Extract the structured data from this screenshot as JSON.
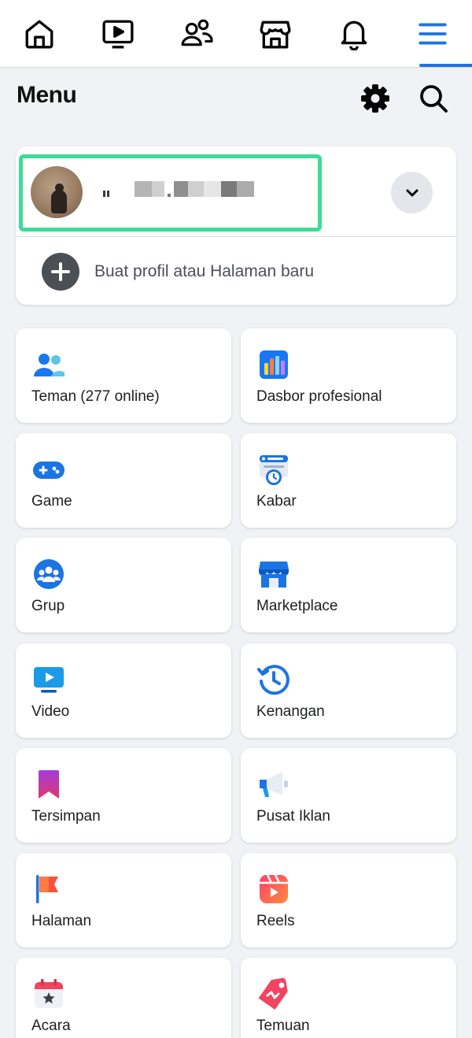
{
  "nav": {
    "tabs": [
      {
        "name": "home",
        "icon": "home-icon"
      },
      {
        "name": "watch",
        "icon": "video-tv-icon"
      },
      {
        "name": "friends",
        "icon": "friends-icon"
      },
      {
        "name": "marketplace",
        "icon": "store-icon"
      },
      {
        "name": "notifications",
        "icon": "bell-icon"
      },
      {
        "name": "menu",
        "icon": "hamburger-menu-icon",
        "active": true
      }
    ],
    "active_color": "#1b74e4"
  },
  "header": {
    "title": "Menu",
    "settings_icon": "gear-icon",
    "search_icon": "search-icon"
  },
  "profile": {
    "name": "",
    "avatar": "avatar",
    "switch_icon": "chevron-down-icon",
    "highlight_color": "#3ddc97",
    "create_label": "Buat profil atau Halaman baru",
    "create_icon": "plus-circle-icon"
  },
  "shortcuts": [
    {
      "label": "Teman (277 online)",
      "icon": "friends-color-icon"
    },
    {
      "label": "Dasbor profesional",
      "icon": "dashboard-bars-icon"
    },
    {
      "label": "Game",
      "icon": "gamepad-icon"
    },
    {
      "label": "Kabar",
      "icon": "feeds-clock-icon"
    },
    {
      "label": "Grup",
      "icon": "groups-icon"
    },
    {
      "label": "Marketplace",
      "icon": "marketplace-store-icon"
    },
    {
      "label": "Video",
      "icon": "video-play-icon"
    },
    {
      "label": "Kenangan",
      "icon": "memories-clock-icon"
    },
    {
      "label": "Tersimpan",
      "icon": "saved-bookmark-icon"
    },
    {
      "label": "Pusat Iklan",
      "icon": "ads-megaphone-icon"
    },
    {
      "label": "Halaman",
      "icon": "pages-flag-icon"
    },
    {
      "label": "Reels",
      "icon": "reels-icon"
    },
    {
      "label": "Acara",
      "icon": "events-calendar-icon"
    },
    {
      "label": "Temuan",
      "icon": "offers-tag-icon"
    }
  ]
}
